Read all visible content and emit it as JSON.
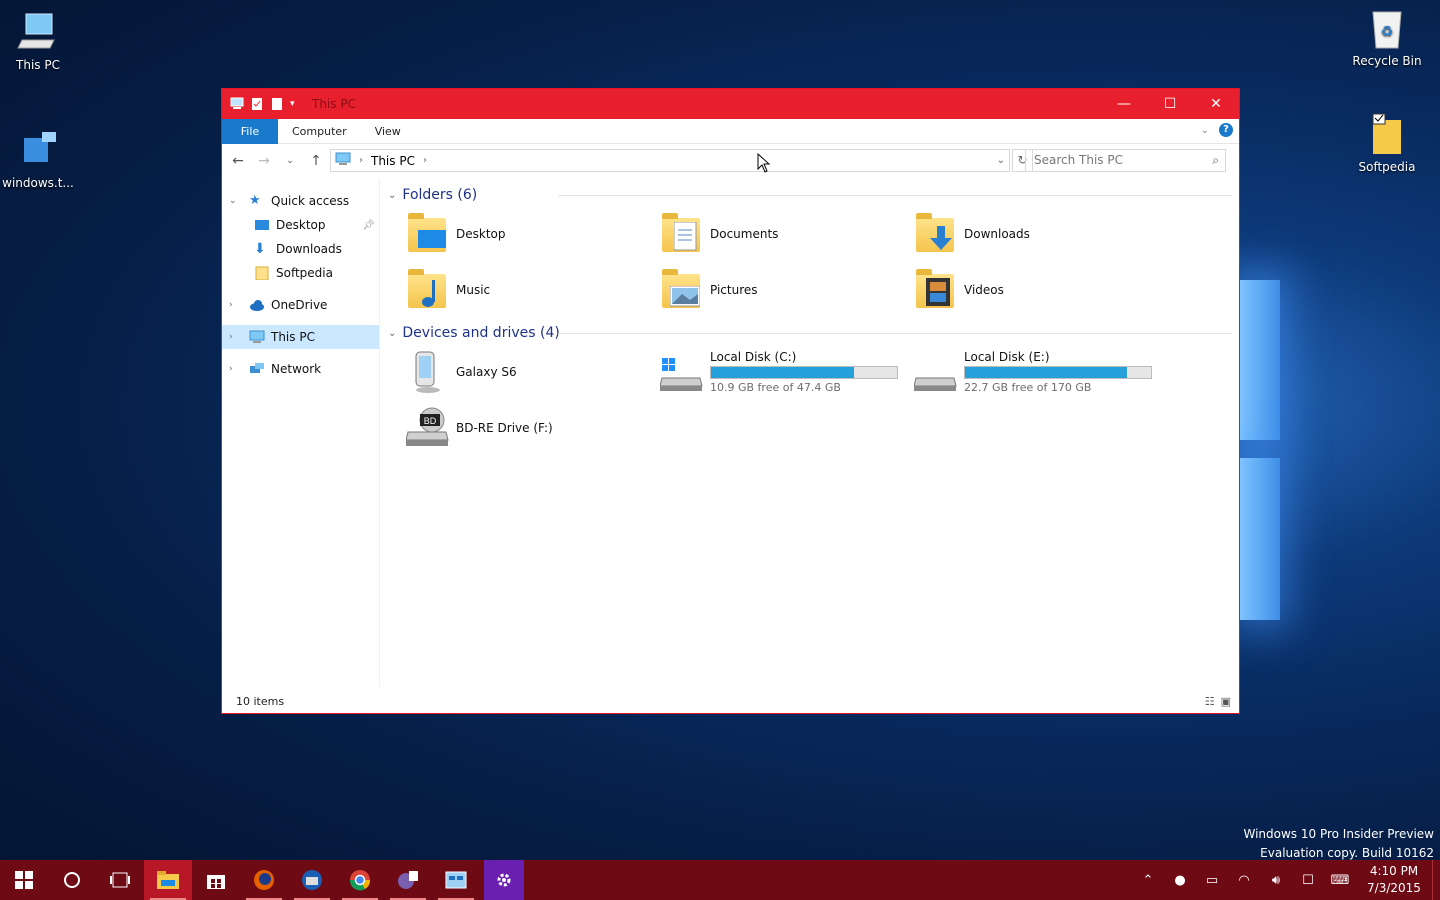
{
  "desktop": {
    "icons": [
      {
        "label": "This PC"
      },
      {
        "label": "windows.t..."
      },
      {
        "label": "Recycle Bin"
      },
      {
        "label": "Softpedia"
      }
    ],
    "watermark": {
      "line1": "Windows 10 Pro Insider Preview",
      "line2": "Evaluation copy. Build 10162"
    }
  },
  "window": {
    "title": "This PC",
    "controls": {
      "minimize": "—",
      "maximize": "☐",
      "close": "✕"
    },
    "ribbon_tabs": [
      "File",
      "Computer",
      "View"
    ],
    "address": {
      "root_sep": "›",
      "location": "This PC",
      "trail_sep": "›"
    },
    "search": {
      "placeholder": "Search This PC"
    },
    "nav_pane": [
      {
        "label": "Quick access",
        "icon": "star-icon"
      },
      {
        "label": "Desktop",
        "icon": "desktop-folder-icon"
      },
      {
        "label": "Downloads",
        "icon": "download-icon"
      },
      {
        "label": "Softpedia",
        "icon": "folder-icon"
      },
      {
        "label": "OneDrive",
        "icon": "cloud-icon"
      },
      {
        "label": "This PC",
        "icon": "computer-icon"
      },
      {
        "label": "Network",
        "icon": "network-icon"
      }
    ],
    "folders_group": "Folders (6)",
    "folders": [
      {
        "label": "Desktop"
      },
      {
        "label": "Documents"
      },
      {
        "label": "Downloads"
      },
      {
        "label": "Music"
      },
      {
        "label": "Pictures"
      },
      {
        "label": "Videos"
      }
    ],
    "devices_group": "Devices and drives (4)",
    "devices": [
      {
        "label": "Galaxy S6"
      },
      {
        "label": "Local Disk (C:)",
        "free": "10.9 GB free of 47.4 GB",
        "used_fraction": 0.77
      },
      {
        "label": "Local Disk (E:)",
        "free": "22.7 GB free of 170 GB",
        "used_fraction": 0.87
      },
      {
        "label": "BD-RE Drive (F:)",
        "badge": "BD"
      }
    ],
    "status": "10 items"
  },
  "taskbar": {
    "clock_time": "4:10 PM",
    "clock_date": "7/3/2015"
  },
  "colors": {
    "accent": "#e8202e",
    "taskbar": "#6e0a14",
    "file_tab": "#1979ca",
    "drive_bar": "#26a0da",
    "group_header": "#1e3287"
  }
}
